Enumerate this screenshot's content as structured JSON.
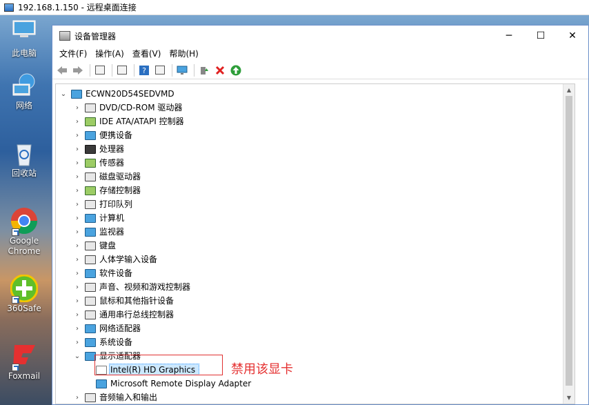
{
  "rdp": {
    "title": "192.168.1.150 - 远程桌面连接"
  },
  "desktop": {
    "icons": [
      {
        "label": "此电脑"
      },
      {
        "label": "网络"
      },
      {
        "label": "回收站"
      },
      {
        "label": "Google Chrome"
      },
      {
        "label": "360Safe"
      },
      {
        "label": "Foxmail"
      }
    ]
  },
  "window": {
    "title": "设备管理器",
    "controls": {
      "minimize": "─",
      "maximize": "☐",
      "close": "✕"
    }
  },
  "menu": [
    "文件(F)",
    "操作(A)",
    "查看(V)",
    "帮助(H)"
  ],
  "tree": {
    "root": "ECWN20D54SEDVMD",
    "categories": [
      "DVD/CD-ROM 驱动器",
      "IDE ATA/ATAPI 控制器",
      "便携设备",
      "处理器",
      "传感器",
      "磁盘驱动器",
      "存储控制器",
      "打印队列",
      "计算机",
      "监视器",
      "键盘",
      "人体学输入设备",
      "软件设备",
      "声音、视频和游戏控制器",
      "鼠标和其他指针设备",
      "通用串行总线控制器",
      "网络适配器",
      "系统设备",
      "显示适配器"
    ],
    "display_children": [
      "Intel(R) HD Graphics",
      "Microsoft Remote Display Adapter"
    ],
    "after": "音频输入和输出"
  },
  "annotation": "禁用该显卡",
  "colors": {
    "annotation": "#e53030",
    "selection": "#cce8ff"
  }
}
